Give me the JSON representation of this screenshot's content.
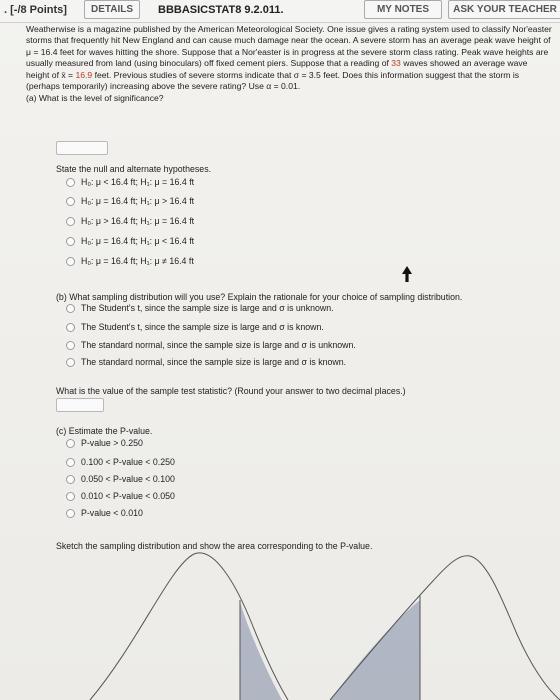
{
  "header": {
    "points": ". [-/8 Points]",
    "details_label": "DETAILS",
    "code": "BBBASICSTAT8 9.2.011.",
    "my_notes_label": "MY NOTES",
    "ask_teacher_label": "ASK YOUR TEACHER"
  },
  "problem": {
    "text_part1": "Weatherwise is a magazine published by the American Meteorological Society. One issue gives a rating system used to classify Nor'easter storms that frequently hit New England and can cause much damage near the ocean. A severe storm has an average peak wave height of μ = 16.4 feet for waves hitting the shore. Suppose that a Nor'easter is in progress at the severe storm class rating. Peak wave heights are usually measured from land (using binoculars) off fixed cement piers. Suppose that a reading of ",
    "n_value": "33",
    "text_part2": " waves showed an average wave height of x̄ = ",
    "xbar_value": "16.9",
    "text_part3": " feet. Previous studies of severe storms indicate that σ = 3.5 feet. Does this information suggest that the storm is (perhaps temporarily) increasing above the severe rating? Use α = 0.01."
  },
  "part_a": {
    "question": "(a) What is the level of significance?",
    "hypotheses_prompt": "State the null and alternate hypotheses.",
    "options": [
      "H₀: μ < 16.4 ft; H₁: μ = 16.4 ft",
      "H₀: μ = 16.4 ft; H₁: μ > 16.4 ft",
      "H₀: μ > 16.4 ft; H₁: μ = 16.4 ft",
      "H₀: μ = 16.4 ft; H₁: μ < 16.4 ft",
      "H₀: μ = 16.4 ft; H₁: μ ≠ 16.4 ft"
    ]
  },
  "part_b": {
    "question": "(b) What sampling distribution will you use? Explain the rationale for your choice of sampling distribution.",
    "options": [
      "The Student's t, since the sample size is large and σ is unknown.",
      "The Student's t, since the sample size is large and σ is known.",
      "The standard normal, since the sample size is large and σ is unknown.",
      "The standard normal, since the sample size is large and σ is known."
    ],
    "test_stat_prompt": "What is the value of the sample test statistic? (Round your answer to two decimal places.)"
  },
  "part_c": {
    "question": "(c) Estimate the P-value.",
    "options": [
      "P-value > 0.250",
      "0.100 < P-value < 0.250",
      "0.050 < P-value < 0.100",
      "0.010 < P-value < 0.050",
      "P-value < 0.010"
    ],
    "sketch_prompt": "Sketch the sampling distribution and show the area corresponding to the P-value."
  },
  "colors": {
    "highlight_red": "#c0392b",
    "curve_shade": "#7f8ca6"
  }
}
